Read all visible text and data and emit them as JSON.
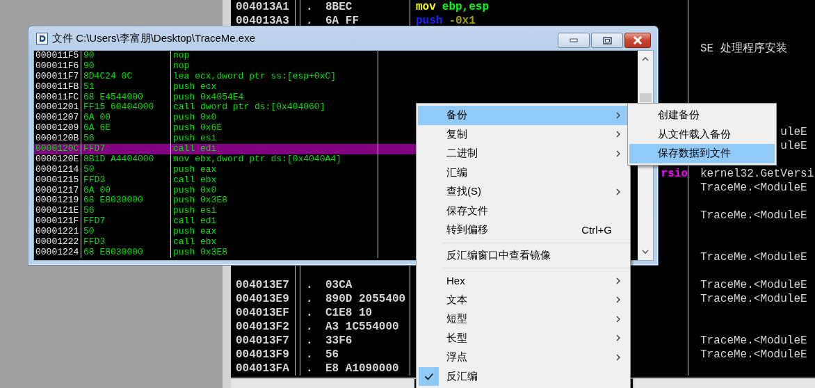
{
  "background_pane": {
    "rows": [
      {
        "address": "004013A1",
        "marker": ".",
        "hex": "8BEC",
        "disasm": [
          {
            "text": "mov",
            "kind": "move"
          },
          {
            "text": "ebp,esp",
            "kind": "register"
          }
        ]
      },
      {
        "address": "004013A3",
        "marker": ".",
        "hex": "6A FF",
        "disasm": [
          {
            "text": "push",
            "kind": "stack"
          },
          {
            "text": "-0x1",
            "kind": "immediate"
          }
        ]
      },
      {},
      {
        "comment": "SE 处理程序安装"
      },
      {},
      {},
      {},
      {},
      {},
      {
        "comment_tail": "uleE"
      },
      {
        "comment_tail": "uleE"
      },
      {},
      {
        "disasm_tail": "rsio",
        "comment": "kernel32.GetVersi"
      },
      {
        "comment": "TraceMe.<ModuleE"
      },
      {},
      {
        "comment": "TraceMe.<ModuleE"
      },
      {},
      {},
      {
        "comment": "TraceMe.<ModuleE"
      },
      {},
      {
        "address": "004013E7",
        "marker": ".",
        "hex": "03CA",
        "comment": "TraceMe.<ModuleE"
      },
      {
        "address": "004013E9",
        "marker": ".",
        "hex": "890D 2055400",
        "comment": "TraceMe.<ModuleE"
      },
      {
        "address": "004013EF",
        "marker": ".",
        "hex": "C1E8 10"
      },
      {
        "address": "004013F2",
        "marker": ".",
        "hex": "A3 1C554000"
      },
      {
        "address": "004013F7",
        "marker": ".",
        "hex": "33F6",
        "comment": "TraceMe.<ModuleE"
      },
      {
        "address": "004013F9",
        "marker": ".",
        "hex": "56",
        "comment": "TraceMe.<ModuleE"
      },
      {
        "address": "004013FA",
        "marker": ".",
        "hex": "E8 A1090000"
      }
    ]
  },
  "popup": {
    "title": "文件 C:\\Users\\李富朋\\Desktop\\TraceMe.exe",
    "rows": [
      {
        "address": "000011F5",
        "hex": "90",
        "disasm": "nop",
        "selected": false
      },
      {
        "address": "000011F6",
        "hex": "90",
        "disasm": "nop",
        "selected": false
      },
      {
        "address": "000011F7",
        "hex": "8D4C24 0C",
        "disasm": "lea ecx,dword ptr ss:[esp+0xC]",
        "selected": false
      },
      {
        "address": "000011FB",
        "hex": "51",
        "disasm": "push ecx",
        "selected": false
      },
      {
        "address": "000011FC",
        "hex": "68 E4544000",
        "disasm": "push 0x4054E4",
        "selected": false
      },
      {
        "address": "00001201",
        "hex": "FF15 60404000",
        "disasm": "call dword ptr ds:[0x404060]",
        "selected": false
      },
      {
        "address": "00001207",
        "hex": "6A 00",
        "disasm": "push 0x0",
        "selected": false
      },
      {
        "address": "00001209",
        "hex": "6A 6E",
        "disasm": "push 0x6E",
        "selected": false
      },
      {
        "address": "0000120B",
        "hex": "56",
        "disasm": "push esi",
        "selected": false
      },
      {
        "address": "0000120C",
        "hex": "FFD7",
        "disasm": "call edi",
        "selected": true
      },
      {
        "address": "0000120E",
        "hex": "8B1D A4404000",
        "disasm": "mov ebx,dword ptr ds:[0x4040A4]",
        "selected": false
      },
      {
        "address": "00001214",
        "hex": "50",
        "disasm": "push eax",
        "selected": false
      },
      {
        "address": "00001215",
        "hex": "FFD3",
        "disasm": "call ebx",
        "selected": false
      },
      {
        "address": "00001217",
        "hex": "6A 00",
        "disasm": "push 0x0",
        "selected": false
      },
      {
        "address": "00001219",
        "hex": "68 E8030000",
        "disasm": "push 0x3E8",
        "selected": false
      },
      {
        "address": "0000121E",
        "hex": "56",
        "disasm": "push esi",
        "selected": false
      },
      {
        "address": "0000121F",
        "hex": "FFD7",
        "disasm": "call edi",
        "selected": false
      },
      {
        "address": "00001221",
        "hex": "50",
        "disasm": "push eax",
        "selected": false
      },
      {
        "address": "00001222",
        "hex": "FFD3",
        "disasm": "call ebx",
        "selected": false
      },
      {
        "address": "00001224",
        "hex": "68 E8030000",
        "disasm": "push 0x3E8",
        "selected": false
      }
    ]
  },
  "context_menu": {
    "items": [
      {
        "kind": "item",
        "label": "备份",
        "submenu": true,
        "selected": true,
        "checked": false
      },
      {
        "kind": "item",
        "label": "复制",
        "submenu": true,
        "selected": false,
        "checked": false
      },
      {
        "kind": "item",
        "label": "二进制",
        "submenu": true,
        "selected": false,
        "checked": false
      },
      {
        "kind": "item",
        "label": "汇编",
        "submenu": false,
        "selected": false,
        "checked": false
      },
      {
        "kind": "item",
        "label": "查找(S)",
        "submenu": true,
        "selected": false,
        "checked": false
      },
      {
        "kind": "item",
        "label": "保存文件",
        "submenu": false,
        "selected": false,
        "checked": false
      },
      {
        "kind": "item",
        "label": "转到偏移",
        "shortcut": "Ctrl+G",
        "submenu": false,
        "selected": false,
        "checked": false
      },
      {
        "kind": "separator"
      },
      {
        "kind": "item",
        "label": "反汇编窗口中查看镜像",
        "submenu": false,
        "selected": false,
        "checked": false
      },
      {
        "kind": "separator"
      },
      {
        "kind": "item",
        "label": "Hex",
        "submenu": true,
        "selected": false,
        "checked": false
      },
      {
        "kind": "item",
        "label": "文本",
        "submenu": true,
        "selected": false,
        "checked": false
      },
      {
        "kind": "item",
        "label": "短型",
        "submenu": true,
        "selected": false,
        "checked": false
      },
      {
        "kind": "item",
        "label": "长型",
        "submenu": true,
        "selected": false,
        "checked": false
      },
      {
        "kind": "item",
        "label": "浮点",
        "submenu": true,
        "selected": false,
        "checked": false
      },
      {
        "kind": "item",
        "label": "反汇编",
        "submenu": false,
        "selected": false,
        "checked": true
      }
    ]
  },
  "submenu": {
    "items": [
      {
        "label": "创建备份",
        "selected": false
      },
      {
        "label": "从文件载入备份",
        "selected": false
      },
      {
        "label": "保存数据到文件",
        "selected": true
      }
    ]
  }
}
